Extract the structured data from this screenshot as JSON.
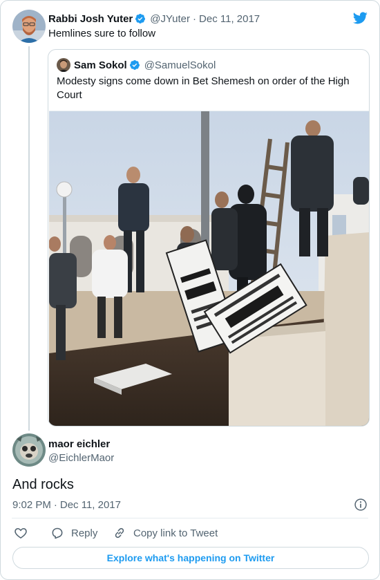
{
  "tweet": {
    "author_name": "Rabbi Josh Yuter",
    "author_handle": "@JYuter",
    "separator": "·",
    "date": "Dec 11, 2017",
    "text": "Hemlines sure to follow"
  },
  "quoted": {
    "author_name": "Sam Sokol",
    "author_handle": "@SamuelSokol",
    "text": "Modesty signs come down in Bet Shemesh on order of the High Court",
    "photo_icon": "photo-of-workers-removing-signs"
  },
  "reply": {
    "author_name": "maor eichler",
    "author_handle": "@EichlerMaor",
    "text": "And rocks",
    "time": "9:02 PM",
    "separator": "·",
    "date": "Dec 11, 2017"
  },
  "actions": {
    "reply_label": "Reply",
    "copy_label": "Copy link to Tweet"
  },
  "footer": {
    "explore_label": "Explore what's happening on Twitter"
  },
  "colors": {
    "accent": "#1d9bf0",
    "muted": "#536471",
    "border": "#cfd9de",
    "heart": "#536471"
  },
  "icons": [
    "twitter-bird-icon",
    "verified-badge-icon",
    "heart-icon",
    "reply-icon",
    "link-icon",
    "info-icon"
  ]
}
